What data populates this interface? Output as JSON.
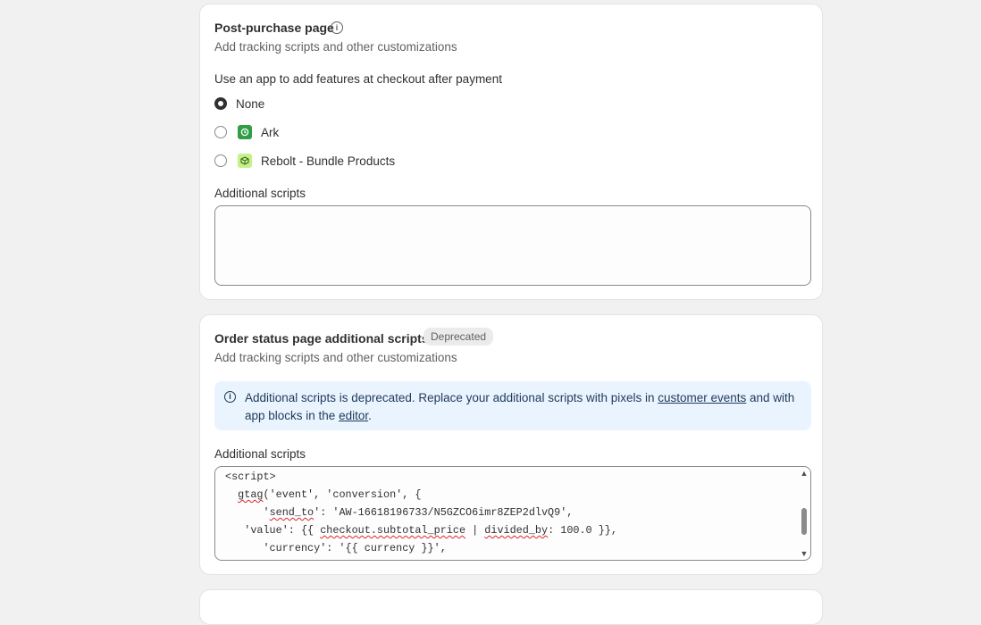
{
  "post_purchase": {
    "title": "Post-purchase page",
    "subtitle": "Add tracking scripts and other customizations",
    "question": "Use an app to add features at checkout after payment",
    "options": [
      {
        "label": "None",
        "checked": true
      },
      {
        "label": "Ark",
        "checked": false,
        "icon": "ark-app-icon"
      },
      {
        "label": "Rebolt - Bundle Products",
        "checked": false,
        "icon": "rebolt-app-icon"
      }
    ],
    "scripts_label": "Additional scripts",
    "scripts_value": ""
  },
  "order_status": {
    "title": "Order status page additional scripts",
    "badge": "Deprecated",
    "subtitle": "Add tracking scripts and other customizations",
    "banner": {
      "text_1": "Additional scripts is deprecated. Replace your additional scripts with pixels in ",
      "link_1": "customer events",
      "text_2": " and with app blocks in the ",
      "link_2": "editor",
      "text_3": "."
    },
    "scripts_label": "Additional scripts",
    "code_lines": [
      "<script>",
      "  gtag('event', 'conversion', {",
      "      'send_to': 'AW-16618196733/N5GZCO6imr8ZEP2dlvQ9',",
      "   'value': {{ checkout.subtotal_price | divided_by: 100.0 }},",
      "      'currency': '{{ currency }}',"
    ]
  },
  "colors": {
    "ark": "#2f9e44",
    "rebolt": "#c6f08a",
    "banner_bg": "#eaf4ff"
  }
}
